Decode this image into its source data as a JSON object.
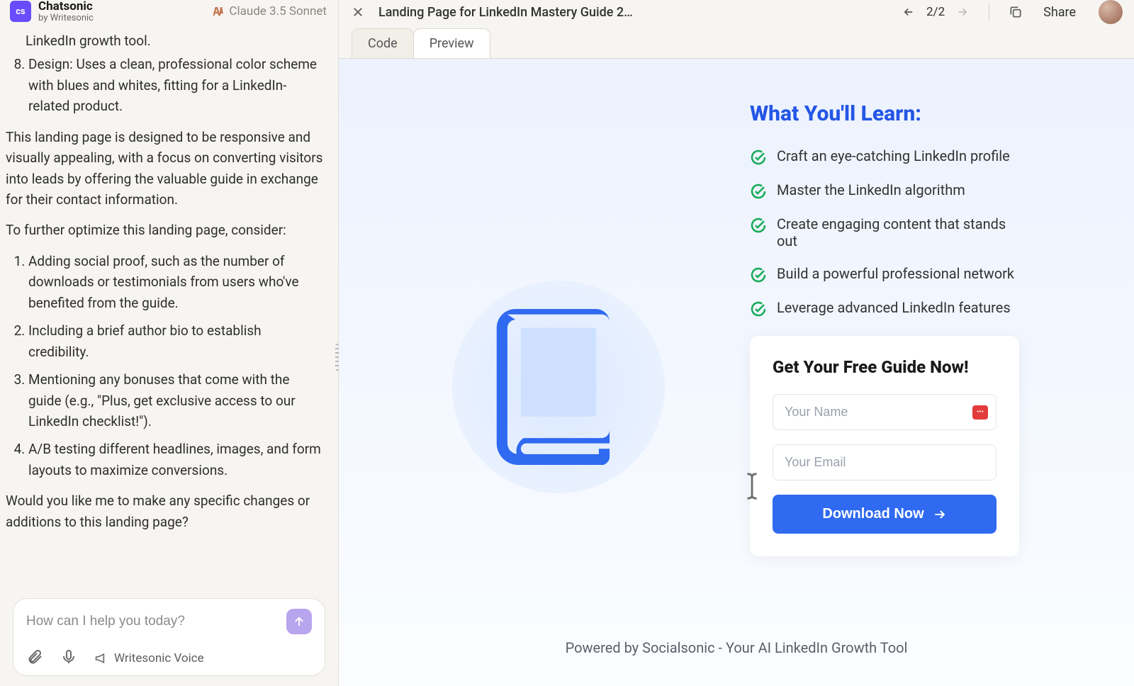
{
  "brand": {
    "badge": "cs",
    "name": "Chatsonic",
    "subtitle": "by Writesonic"
  },
  "model_label": "Claude 3.5 Sonnet",
  "chat": {
    "line_tail": "LinkedIn growth tool.",
    "item8": "Design: Uses a clean, professional color scheme with blues and whites, fitting for a LinkedIn-related product.",
    "para1": "This landing page is designed to be responsive and visually appealing, with a focus on converting visitors into leads by offering the valuable guide in exchange for their contact information.",
    "para2": "To further optimize this landing page, consider:",
    "opt1": "Adding social proof, such as the number of downloads or testimonials from users who've benefited from the guide.",
    "opt2": "Including a brief author bio to establish credibility.",
    "opt3": "Mentioning any bonuses that come with the guide (e.g., \"Plus, get exclusive access to our LinkedIn checklist!\").",
    "opt4": "A/B testing different headlines, images, and form layouts to maximize conversions.",
    "closing": "Would you like me to make any specific changes or additions to this landing page?"
  },
  "composer": {
    "placeholder": "How can I help you today?",
    "voice_label": "Writesonic Voice"
  },
  "artifact": {
    "title": "Landing Page for LinkedIn Mastery Guide 2…",
    "page_index": "2/2",
    "share_label": "Share",
    "tabs": {
      "code": "Code",
      "preview": "Preview"
    }
  },
  "preview": {
    "learn_title": "What You'll Learn:",
    "learn_items": {
      "i0": "Craft an eye-catching LinkedIn profile",
      "i1": "Master the LinkedIn algorithm",
      "i2": "Create engaging content that stands out",
      "i3": "Build a powerful professional network",
      "i4": "Leverage advanced LinkedIn features"
    },
    "form": {
      "title": "Get Your Free Guide Now!",
      "name_placeholder": "Your Name",
      "email_placeholder": "Your Email",
      "cta": "Download Now"
    },
    "powered": "Powered by Socialsonic - Your AI LinkedIn Growth Tool"
  }
}
